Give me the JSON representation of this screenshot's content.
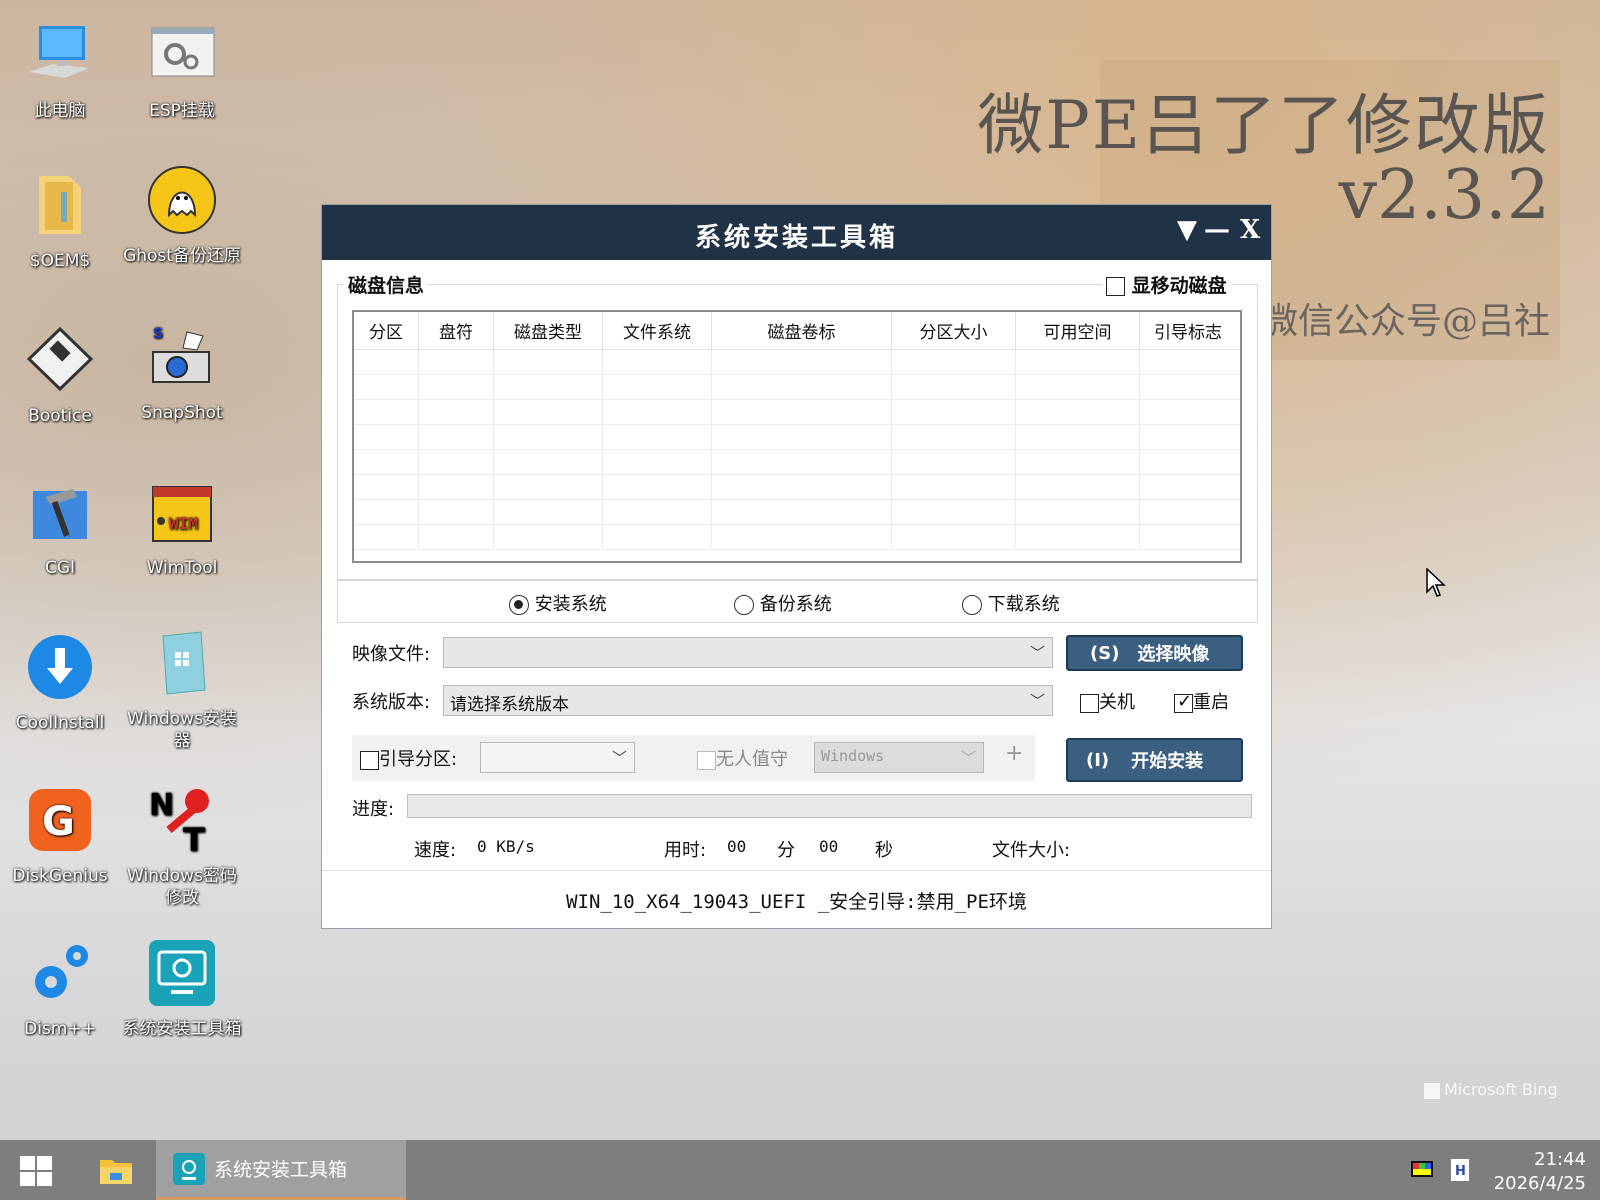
{
  "desktop": {
    "icons": [
      {
        "label": "此电脑",
        "icon": "computer-icon"
      },
      {
        "label": "ESP挂载",
        "icon": "gears-window-icon"
      },
      {
        "label": "$OEM$",
        "icon": "folder-icon"
      },
      {
        "label": "Ghost备份还原",
        "icon": "ghost-icon"
      },
      {
        "label": "Bootice",
        "icon": "floppy-icon"
      },
      {
        "label": "SnapShot",
        "icon": "camera-icon"
      },
      {
        "label": "CGI",
        "icon": "hammer-icon"
      },
      {
        "label": "WimTool",
        "icon": "wim-box-icon"
      },
      {
        "label": "CoolInstall",
        "icon": "download-arrow-icon"
      },
      {
        "label": "Windows安装器",
        "icon": "windows-installer-icon"
      },
      {
        "label": "DiskGenius",
        "icon": "diskgenius-icon"
      },
      {
        "label": "Windows密码修改",
        "icon": "password-key-icon"
      },
      {
        "label": "Dism++",
        "icon": "gear-pair-icon"
      },
      {
        "label": "系统安装工具箱",
        "icon": "installer-toolbox-icon"
      }
    ],
    "watermark": {
      "title": "微PE吕了了修改版",
      "version": "v2.3.2",
      "subtitle": "微信公众号@吕社"
    },
    "bing_label": "Microsoft Bing"
  },
  "dialog": {
    "title": "系统安装工具箱",
    "controls": {
      "menu": "▼",
      "minimize": "—",
      "close": "X"
    },
    "disk_group_label": "磁盘信息",
    "show_removable_label": "显移动磁盘",
    "show_removable_checked": false,
    "table": {
      "columns": [
        "分区",
        "盘符",
        "磁盘类型",
        "文件系统",
        "磁盘卷标",
        "分区大小",
        "可用空间",
        "引导标志"
      ],
      "rows": []
    },
    "modes": [
      {
        "label": "安装系统",
        "selected": true
      },
      {
        "label": "备份系统",
        "selected": false
      },
      {
        "label": "下载系统",
        "selected": false
      }
    ],
    "image_file_label": "映像文件:",
    "image_file_value": "",
    "select_image_button": {
      "hotkey": "(S)",
      "label": "选择映像"
    },
    "version_label": "系统版本:",
    "version_value": "请选择系统版本",
    "shutdown_label": "关机",
    "shutdown_checked": false,
    "reboot_label": "重启",
    "reboot_checked": true,
    "boot_partition_label": "引导分区:",
    "boot_partition_checked": false,
    "unattended_label": "无人值守",
    "unattended_value": "Windows",
    "plus_label": "+",
    "start_button": {
      "hotkey": "(I)",
      "label": "开始安装"
    },
    "progress_label": "进度:",
    "progress": 0,
    "speed_label": "速度:",
    "speed_value": "0 KB/s",
    "time_label": "用时:",
    "minutes": "00",
    "minutes_unit": "分",
    "seconds": "00",
    "seconds_unit": "秒",
    "file_size_label": "文件大小:",
    "status_line": "WIN_10_X64_19043_UEFI _安全引导:禁用_PE环境"
  },
  "taskbar": {
    "app_label": "系统安装工具箱",
    "clock_time": "21:44",
    "clock_date": "2026/4/25",
    "colors": {
      "taskbar": "#7e7e80",
      "accent": "#d49a64"
    }
  }
}
